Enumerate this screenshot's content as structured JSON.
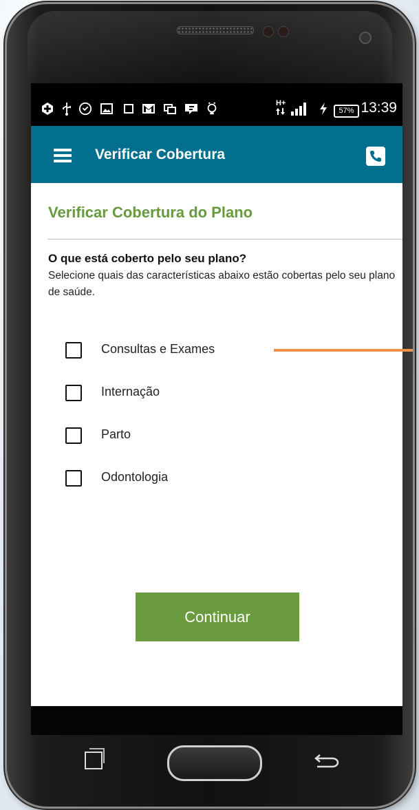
{
  "status_bar": {
    "time": "13:39",
    "battery": "57%",
    "network": "H+",
    "icons": [
      "plus-icon",
      "usb-icon",
      "whatsapp-icon",
      "image-icon",
      "notification-icon",
      "gmail-icon",
      "cast-icon",
      "messenger-icon",
      "bulb-icon",
      "signal-icon",
      "charging-icon"
    ]
  },
  "app_bar": {
    "title": "Verificar Cobertura",
    "menu_icon": "hamburger-menu-icon",
    "action_icon": "phone-icon"
  },
  "page": {
    "section_title": "Verificar Cobertura do Plano",
    "question": "O que está coberto pelo seu plano?",
    "description": "Selecione quais das características abaixo estão cobertas pelo seu plano de saúde.",
    "options": [
      {
        "label": "Consultas e Exames",
        "checked": false
      },
      {
        "label": "Internação",
        "checked": false
      },
      {
        "label": "Parto",
        "checked": false
      },
      {
        "label": "Odontologia",
        "checked": false
      }
    ],
    "continue_label": "Continuar"
  },
  "colors": {
    "app_bar": "#036f8f",
    "accent_green": "#679a3d",
    "button_green": "#6b9b3f",
    "pointer_orange": "#f0924a"
  }
}
